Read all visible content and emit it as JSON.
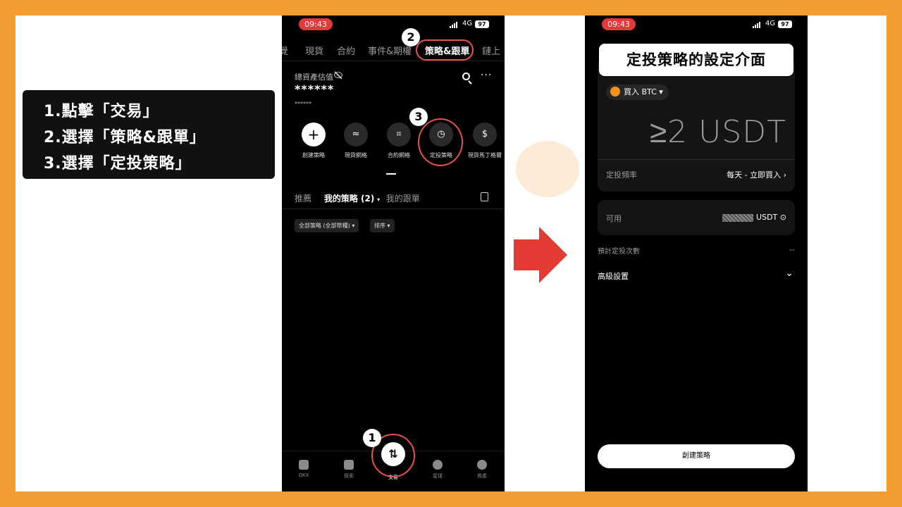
{
  "instructions": [
    "1.點擊「交易」",
    "2.選擇「策略&跟單」",
    "3.選擇「定投策略」"
  ],
  "left_phone": {
    "time": "09:43",
    "network": "4G",
    "battery": "97",
    "tabs": [
      "覺",
      "現貨",
      "合約",
      "事件&期權",
      "策略&跟單",
      "鏈上"
    ],
    "asset_label": "總資產估值",
    "asset_value": "******",
    "asset_sub": "******",
    "actions": [
      "創建策略",
      "現貨網格",
      "合約網格",
      "定投策略",
      "現貨馬丁格爾"
    ],
    "subtabs": {
      "recommend": "推薦",
      "mine": "我的策略 (2)",
      "follow": "我的跟單"
    },
    "chips": [
      "全部策略 (全部幣種)",
      "排序"
    ],
    "nav": [
      "OKX",
      "探索",
      "交易",
      "星球",
      "資產"
    ],
    "badges": [
      "1",
      "2",
      "3"
    ]
  },
  "right_phone": {
    "time": "09:43",
    "network": "4G",
    "battery": "97",
    "title": "定投策略的設定介面",
    "buy_label": "買入 BTC",
    "amount_placeholder": "≥2 USDT",
    "freq_label": "定投頻率",
    "freq_value": "每天 - 立即買入",
    "available_label": "可用",
    "available_unit": "USDT",
    "count_label": "預計定投次數",
    "count_value": "--",
    "advanced_label": "高級設置",
    "create_button": "創建策略"
  },
  "colors": {
    "background": "#F39C2F",
    "highlight": "#E5534B",
    "arrow": "#E23B33"
  }
}
